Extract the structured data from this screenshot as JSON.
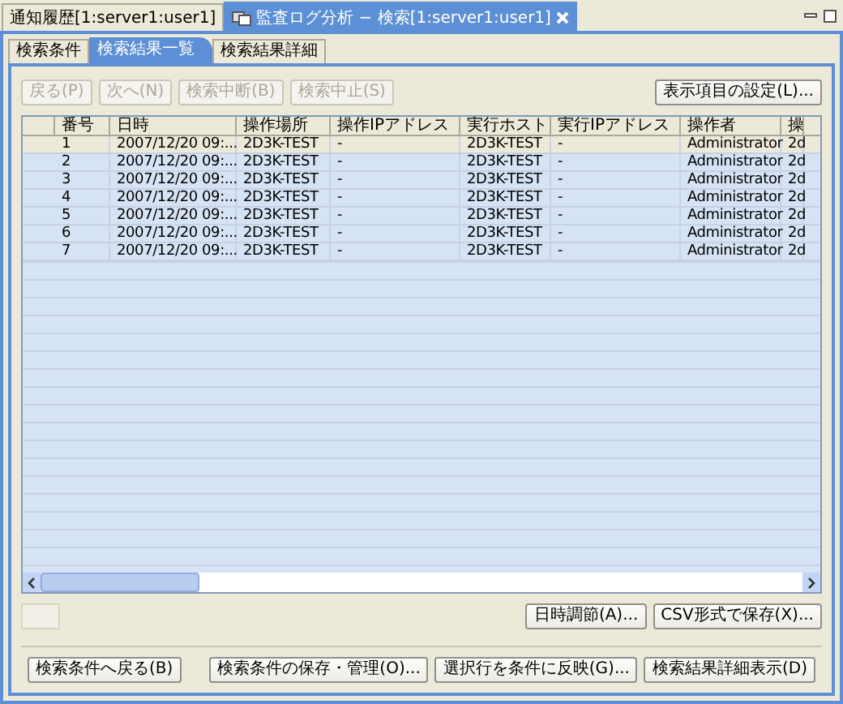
{
  "editor_tabs": [
    {
      "label": "通知履歴[1:server1:user1]",
      "selected": false
    },
    {
      "label": "監査ログ分析 − 検索[1:server1:user1]",
      "selected": true
    }
  ],
  "view_tabs": [
    {
      "label": "検索条件",
      "selected": false
    },
    {
      "label": "検索結果一覧",
      "selected": true
    },
    {
      "label": "検索結果詳細",
      "selected": false
    }
  ],
  "toolbar": {
    "buttons": [
      {
        "label": "戻る(P)",
        "disabled": true
      },
      {
        "label": "次へ(N)",
        "disabled": true
      },
      {
        "label": "検索中断(B)",
        "disabled": true
      },
      {
        "label": "検索中止(S)",
        "disabled": true
      }
    ],
    "settings_button": "表示項目の設定(L)..."
  },
  "table": {
    "columns": [
      "番号",
      "日時",
      "操作場所",
      "操作IPアドレス",
      "実行ホスト",
      "実行IPアドレス",
      "操作者",
      "操"
    ],
    "rows": [
      {
        "selected": true,
        "cells": [
          "1",
          "2007/12/20 09:...",
          "2D3K-TEST",
          "-",
          "2D3K-TEST",
          "-",
          "Administrator",
          "2d"
        ]
      },
      {
        "selected": false,
        "cells": [
          "2",
          "2007/12/20 09:...",
          "2D3K-TEST",
          "-",
          "2D3K-TEST",
          "-",
          "Administrator",
          "2d"
        ]
      },
      {
        "selected": false,
        "cells": [
          "3",
          "2007/12/20 09:...",
          "2D3K-TEST",
          "-",
          "2D3K-TEST",
          "-",
          "Administrator",
          "2d"
        ]
      },
      {
        "selected": false,
        "cells": [
          "4",
          "2007/12/20 09:...",
          "2D3K-TEST",
          "-",
          "2D3K-TEST",
          "-",
          "Administrator",
          "2d"
        ]
      },
      {
        "selected": false,
        "cells": [
          "5",
          "2007/12/20 09:...",
          "2D3K-TEST",
          "-",
          "2D3K-TEST",
          "-",
          "Administrator",
          "2d"
        ]
      },
      {
        "selected": false,
        "cells": [
          "6",
          "2007/12/20 09:...",
          "2D3K-TEST",
          "-",
          "2D3K-TEST",
          "-",
          "Administrator",
          "2d"
        ]
      },
      {
        "selected": false,
        "cells": [
          "7",
          "2007/12/20 09:...",
          "2D3K-TEST",
          "-",
          "2D3K-TEST",
          "-",
          "Administrator",
          "2d"
        ]
      }
    ]
  },
  "result_actions": [
    "日時調節(A)...",
    "CSV形式で保存(X)..."
  ],
  "footer_left": "検索条件へ戻る(B)",
  "footer_right": [
    "検索条件の保存・管理(O)...",
    "選択行を条件に反映(G)...",
    "検索結果詳細表示(D)"
  ]
}
